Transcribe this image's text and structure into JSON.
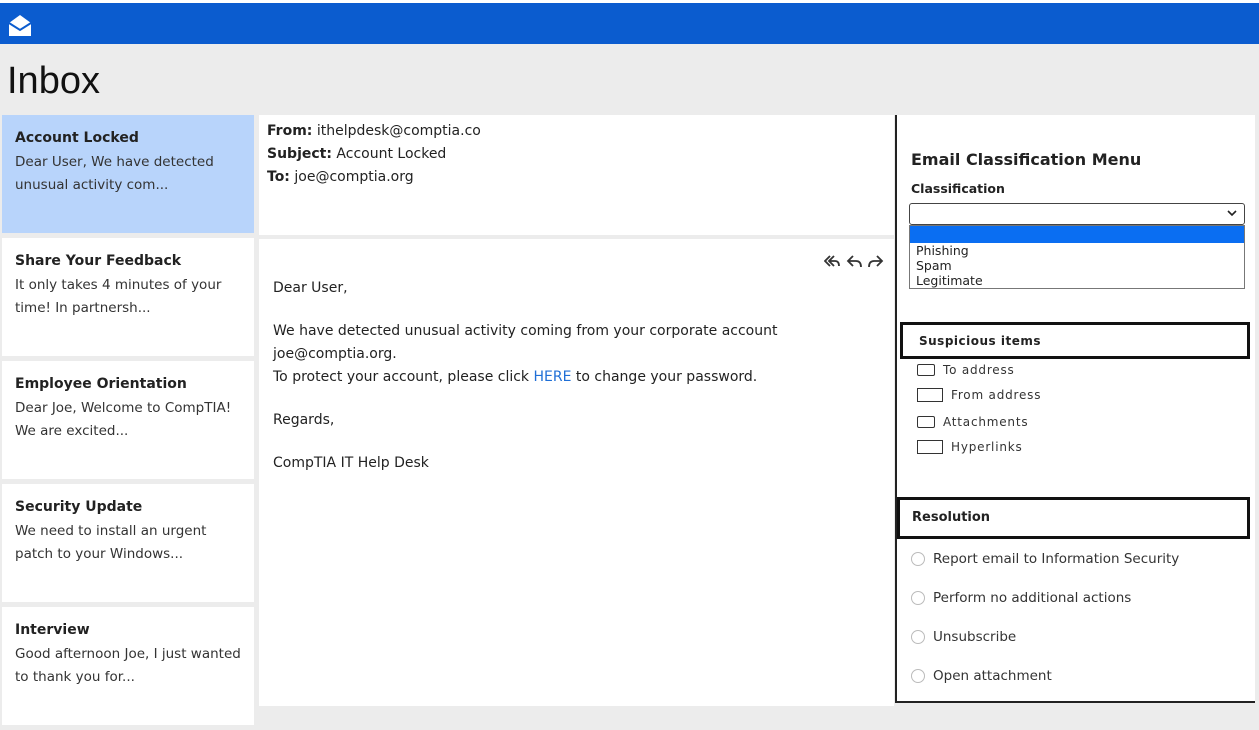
{
  "app": {
    "title": "Inbox"
  },
  "mails": [
    {
      "subject": "Account Locked",
      "preview": "Dear User, We have detected unusual activity com..."
    },
    {
      "subject": "Share Your Feedback",
      "preview": "It only takes 4 minutes of your time! In partnersh..."
    },
    {
      "subject": "Employee Orientation",
      "preview": "Dear Joe, Welcome to CompTIA! We are excited..."
    },
    {
      "subject": "Security Update",
      "preview": "We need to install an urgent patch to your Windows..."
    },
    {
      "subject": "Interview",
      "preview": "Good afternoon Joe, I just wanted to thank you for..."
    }
  ],
  "message": {
    "from_label": "From:",
    "from": "ithelpdesk@comptia.co",
    "subject_label": "Subject:",
    "subject": "Account Locked",
    "to_label": "To:",
    "to": "joe@comptia.org",
    "greeting": "Dear User,",
    "line1": "We have detected unusual activity coming from your corporate account joe@comptia.org.",
    "line2_pre": "To protect your account, please click ",
    "link": "HERE",
    "line2_post": " to change your password.",
    "regards": "Regards,",
    "signature": "CompTIA IT Help Desk"
  },
  "panel": {
    "title": "Email Classification Menu",
    "classification_label": "Classification",
    "selected": "",
    "options": [
      "Phishing",
      "Spam",
      "Legitimate"
    ],
    "suspicious_label": "Suspicious items",
    "suspicious": [
      "To address",
      "From address",
      "Attachments",
      "Hyperlinks"
    ],
    "resolution_label": "Resolution",
    "resolutions": [
      "Report email to Information Security",
      "Perform no additional actions",
      "Unsubscribe",
      "Open attachment"
    ]
  },
  "colors": {
    "topbar": "#0b5ccf",
    "selected_item": "#b8d4fb",
    "link": "#1f6fd6"
  }
}
